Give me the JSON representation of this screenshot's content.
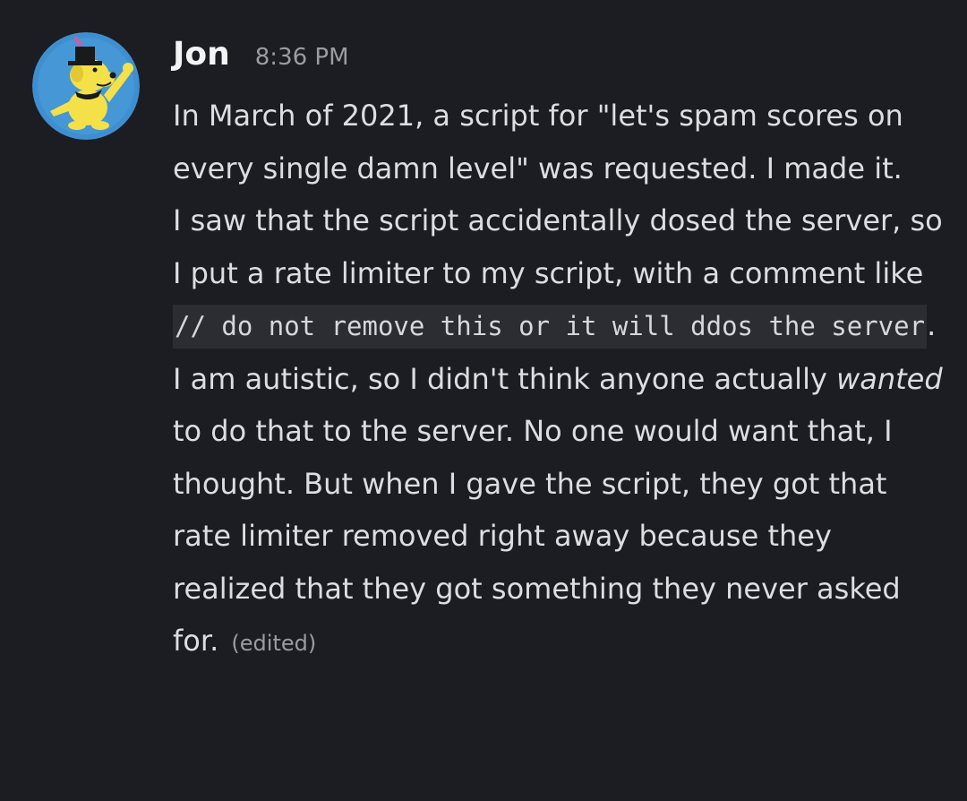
{
  "message": {
    "author": "Jon",
    "timestamp": "8:36 PM",
    "avatar_icon": "yellow-cartoon-dog-avatar-icon",
    "paragraphs": {
      "p1": "In March of 2021, a script for \"let's spam scores on every single damn level\" was requested. I made it.",
      "p2_before": "I saw that the script accidentally dosed the server, so I put a rate limiter to my script, with a comment like ",
      "p2_code": "// do not remove this or it will ddos the server",
      "p2_after": ".",
      "p3_before": "I am autistic, so I didn't think anyone actually ",
      "p3_em": "wanted",
      "p3_after": " to do that to the server. No one would want that, I thought. But when I gave the script, they got that rate limiter removed right away because they realized that they got something they never asked for."
    },
    "edited_label": "(edited)"
  },
  "colors": {
    "background": "#1c1d22",
    "username": "#f2f3f5",
    "text": "#dcdde1",
    "muted": "#9a9ca3",
    "code_bg": "#2b2d33"
  }
}
